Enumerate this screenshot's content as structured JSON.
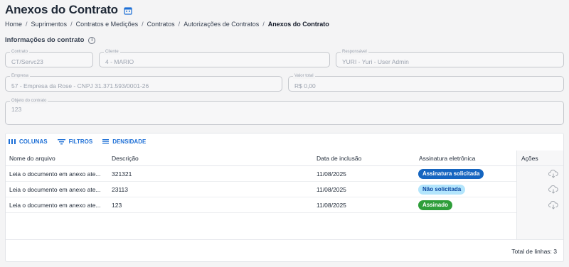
{
  "header": {
    "title": "Anexos do Contrato"
  },
  "breadcrumb": [
    "Home",
    "Suprimentos",
    "Contratos e Medições",
    "Contratos",
    "Autorizações de Contratos",
    "Anexos do Contrato"
  ],
  "section": {
    "title": "Informações do contrato"
  },
  "fields": {
    "contrato": {
      "label": "Contrato",
      "value": "CT/Servc23"
    },
    "cliente": {
      "label": "Cliente",
      "value": "4 - MARIO"
    },
    "responsavel": {
      "label": "Responsável",
      "value": "YURI - Yuri - User Admin"
    },
    "empresa": {
      "label": "Empresa",
      "value": "57 - Empresa da Rose - CNPJ 31.371.593/0001-26"
    },
    "valor_total": {
      "label": "Valor total",
      "value": "R$ 0,00"
    },
    "objeto": {
      "label": "Objeto do contrato",
      "value": "123"
    }
  },
  "toolbar": {
    "colunas": "COLUNAS",
    "filtros": "FILTROS",
    "densidade": "DENSIDADE"
  },
  "table": {
    "columns": [
      "Nome do arquivo",
      "Descrição",
      "Data de inclusão",
      "Assinatura eletrônica",
      "Ações"
    ],
    "rows": [
      {
        "nome": "Leia o documento em anexo ate...",
        "descricao": "321321",
        "data": "11/08/2025",
        "assinatura": "Assinatura solicitada",
        "status": "solicitada"
      },
      {
        "nome": "Leia o documento em anexo ate...",
        "descricao": "23113",
        "data": "11/08/2025",
        "assinatura": "Não solicitada",
        "status": "nao"
      },
      {
        "nome": "Leia o documento em anexo ate...",
        "descricao": "123",
        "data": "11/08/2025",
        "assinatura": "Assinado",
        "status": "assinado"
      }
    ],
    "total": "Total de linhas: 3"
  },
  "colors": {
    "accent": "#1d6fd6",
    "badge_solicitada": "#1565c0",
    "badge_nao_bg": "#b3e5fc",
    "badge_nao_text": "#0d47a1",
    "badge_assinado": "#2e9e3a"
  },
  "icons": {
    "title": "calendar-icon",
    "section": "info-icon",
    "columns": "columns-icon",
    "filters": "filter-icon",
    "density": "density-icon",
    "action": "cloud-download-icon"
  }
}
